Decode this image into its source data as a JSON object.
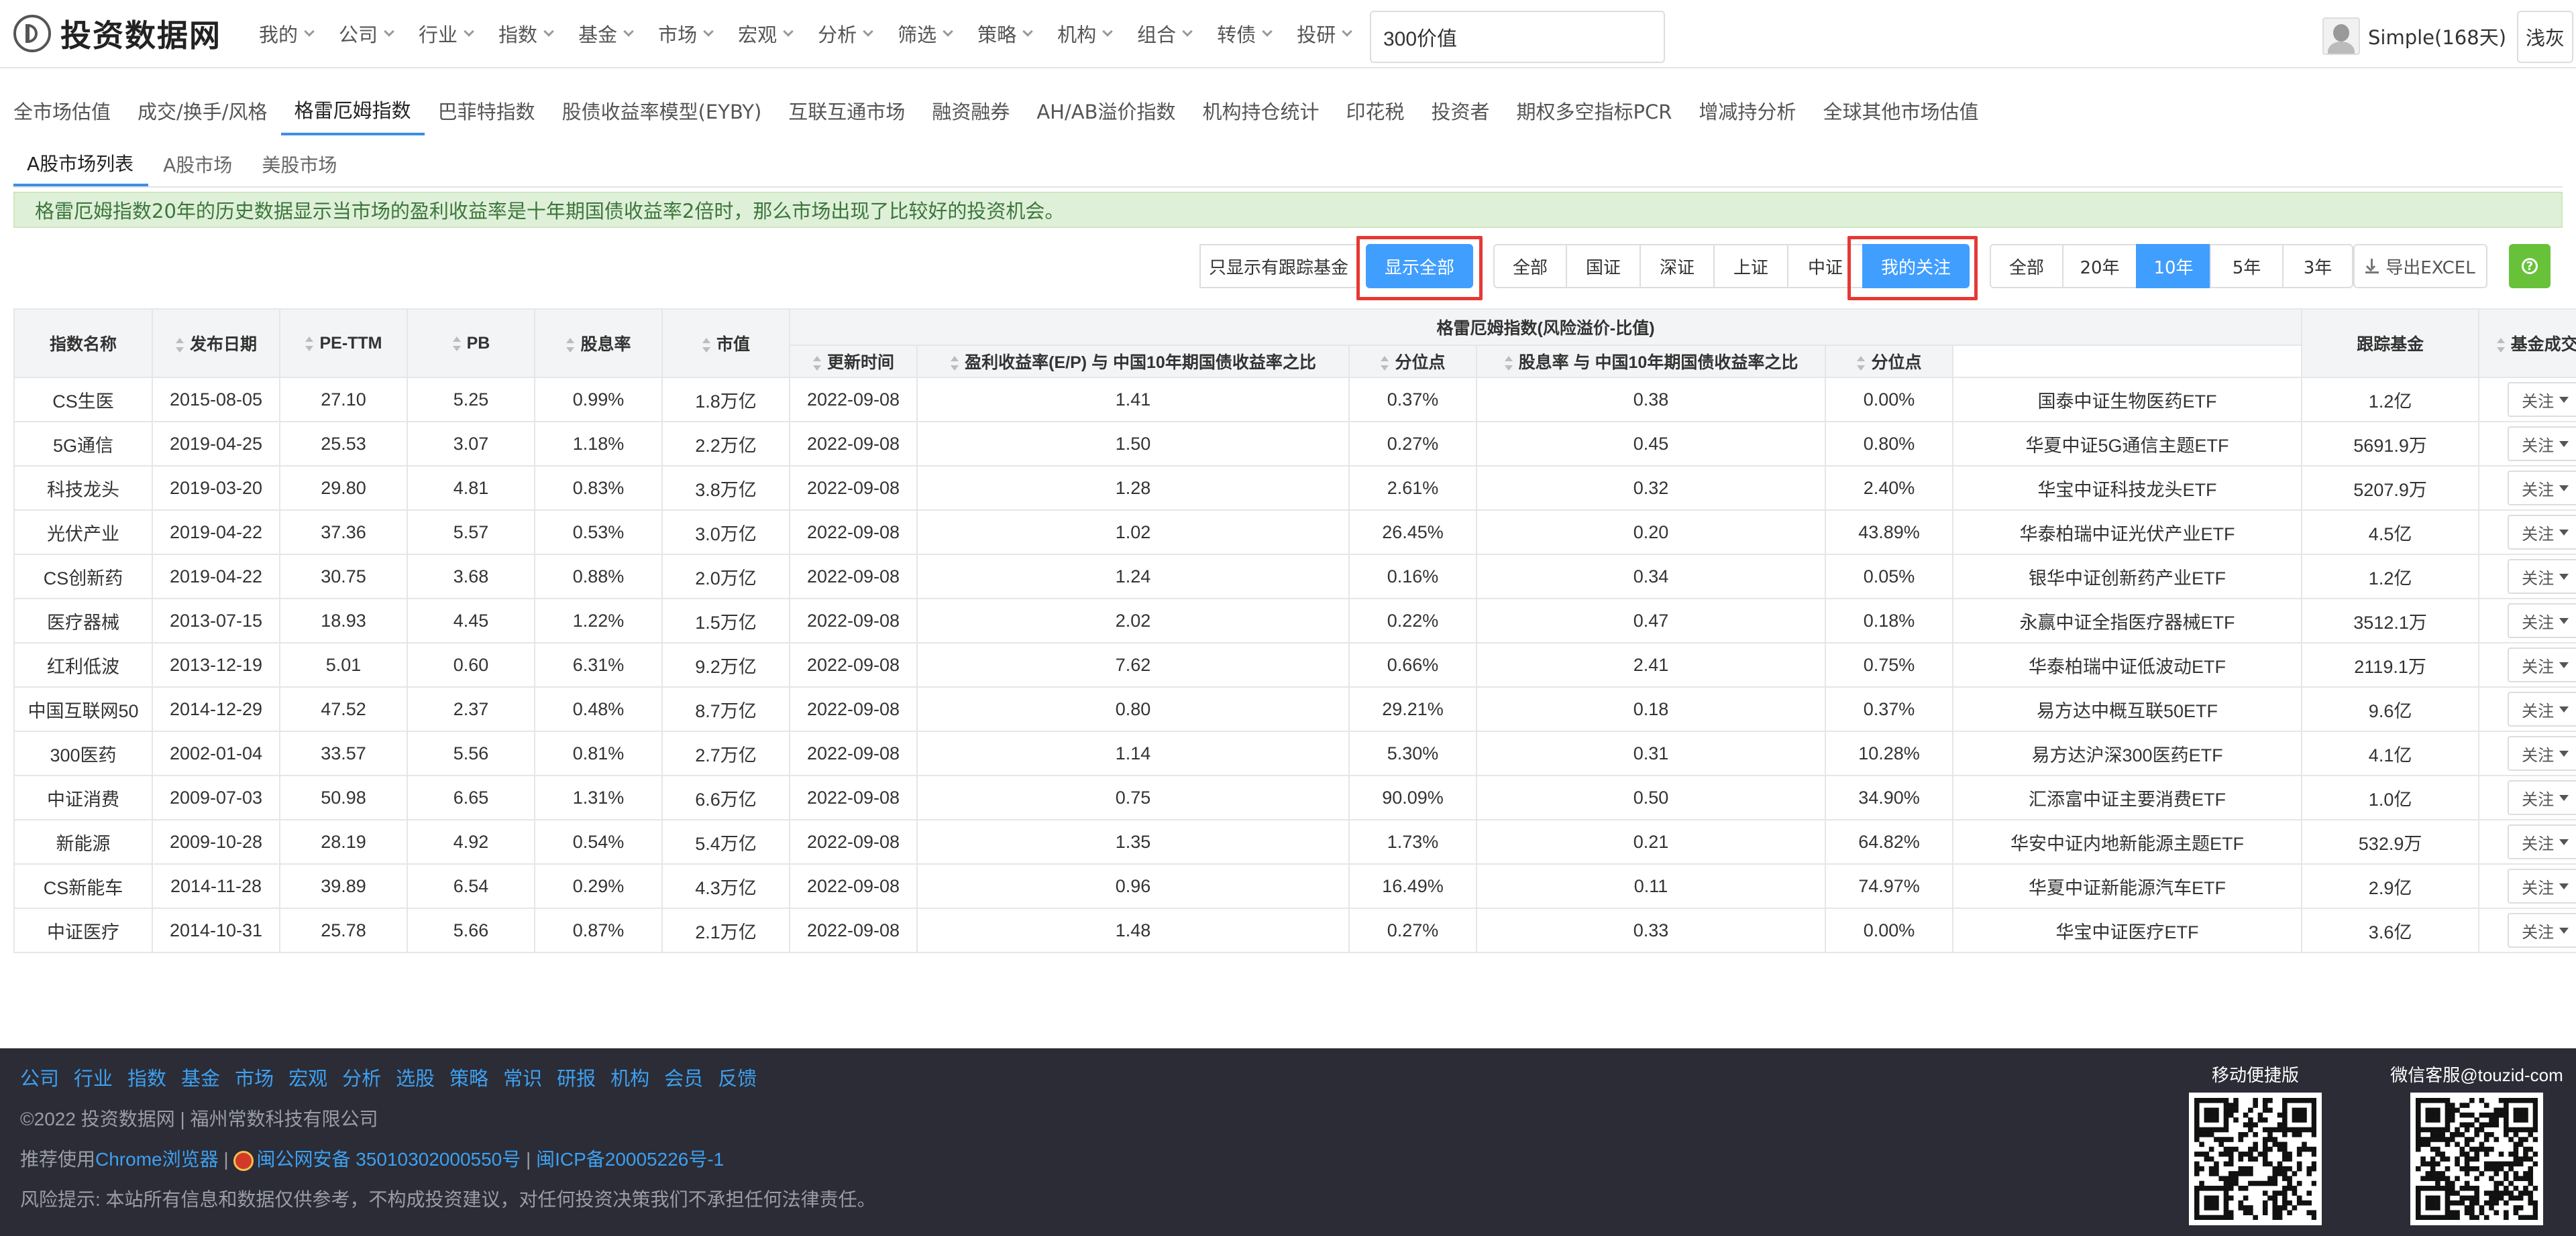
{
  "header": {
    "site_name": "投资数据网",
    "nav": [
      "我的",
      "公司",
      "行业",
      "指数",
      "基金",
      "市场",
      "宏观",
      "分析",
      "筛选",
      "策略",
      "机构",
      "组合",
      "转债",
      "投研"
    ],
    "search_value": "300价值",
    "user_name": "Simple(168天)",
    "theme_label": "浅灰"
  },
  "tabs": {
    "primary": [
      "全市场估值",
      "成交/换手/风格",
      "格雷厄姆指数",
      "巴菲特指数",
      "股债收益率模型(EYBY)",
      "互联互通市场",
      "融资融券",
      "AH/AB溢价指数",
      "机构持仓统计",
      "印花税",
      "投资者",
      "期权多空指标PCR",
      "增减持分析",
      "全球其他市场估值"
    ],
    "primary_active": "格雷厄姆指数",
    "secondary": [
      "A股市场列表",
      "A股市场",
      "美股市场"
    ],
    "secondary_active": "A股市场列表"
  },
  "notice": "格雷厄姆指数20年的历史数据显示当市场的盈利收益率是十年期国债收益率2倍时，那么市场出现了比较好的投资机会。",
  "filters": {
    "tracking_only": "只显示有跟踪基金",
    "show_all": "显示全部",
    "markets": [
      "全部",
      "国证",
      "深证",
      "上证",
      "中证",
      "我的关注"
    ],
    "periods": [
      "全部",
      "20年",
      "10年",
      "5年",
      "3年"
    ],
    "period_active": "10年",
    "export": "导出EXCEL",
    "help": "?"
  },
  "table": {
    "headers": {
      "name": "指数名称",
      "date": "发布日期",
      "pe": "PE-TTM",
      "pb": "PB",
      "dy": "股息率",
      "mcap": "市值",
      "group": "格雷厄姆指数(风险溢价-比值)",
      "update": "更新时间",
      "ep_ratio": "盈利收益率(E/P) 与 中国10年期国债收益率之比",
      "pct1": "分位点",
      "dy_ratio": "股息率 与 中国10年期国债收益率之比",
      "pct2": "分位点",
      "fund": "跟踪基金",
      "fund_volume": "基金成交额",
      "follow": "关注"
    },
    "follow_label": "关注",
    "rows": [
      {
        "name": "CS生医",
        "date": "2015-08-05",
        "pe": "27.10",
        "pb": "5.25",
        "dy": "0.99%",
        "mcap": "1.8万亿",
        "update": "2022-09-08",
        "ep": "1.41",
        "p1": "0.37%",
        "p1c": "g",
        "dyr": "0.38",
        "p2": "0.00%",
        "p2c": "g",
        "fund": "国泰中证生物医药ETF",
        "vol": "1.2亿"
      },
      {
        "name": "5G通信",
        "date": "2019-04-25",
        "pe": "25.53",
        "pb": "3.07",
        "dy": "1.18%",
        "mcap": "2.2万亿",
        "update": "2022-09-08",
        "ep": "1.50",
        "p1": "0.27%",
        "p1c": "g",
        "dyr": "0.45",
        "p2": "0.80%",
        "p2c": "g",
        "fund": "华夏中证5G通信主题ETF",
        "vol": "5691.9万"
      },
      {
        "name": "科技龙头",
        "date": "2019-03-20",
        "pe": "29.80",
        "pb": "4.81",
        "dy": "0.83%",
        "mcap": "3.8万亿",
        "update": "2022-09-08",
        "ep": "1.28",
        "p1": "2.61%",
        "p1c": "g",
        "dyr": "0.32",
        "p2": "2.40%",
        "p2c": "g",
        "fund": "华宝中证科技龙头ETF",
        "vol": "5207.9万"
      },
      {
        "name": "光伏产业",
        "date": "2019-04-22",
        "pe": "37.36",
        "pb": "5.57",
        "dy": "0.53%",
        "mcap": "3.0万亿",
        "update": "2022-09-08",
        "ep": "1.02",
        "p1": "26.45%",
        "p1c": "b",
        "dyr": "0.20",
        "p2": "43.89%",
        "p2c": "b",
        "fund": "华泰柏瑞中证光伏产业ETF",
        "vol": "4.5亿"
      },
      {
        "name": "CS创新药",
        "date": "2019-04-22",
        "pe": "30.75",
        "pb": "3.68",
        "dy": "0.88%",
        "mcap": "2.0万亿",
        "update": "2022-09-08",
        "ep": "1.24",
        "p1": "0.16%",
        "p1c": "g",
        "dyr": "0.34",
        "p2": "0.05%",
        "p2c": "g",
        "fund": "银华中证创新药产业ETF",
        "vol": "1.2亿"
      },
      {
        "name": "医疗器械",
        "date": "2013-07-15",
        "pe": "18.93",
        "pb": "4.45",
        "dy": "1.22%",
        "mcap": "1.5万亿",
        "update": "2022-09-08",
        "ep": "2.02",
        "p1": "0.22%",
        "p1c": "g",
        "dyr": "0.47",
        "p2": "0.18%",
        "p2c": "g",
        "fund": "永赢中证全指医疗器械ETF",
        "vol": "3512.1万"
      },
      {
        "name": "红利低波",
        "date": "2013-12-19",
        "pe": "5.01",
        "pb": "0.60",
        "dy": "6.31%",
        "mcap": "9.2万亿",
        "update": "2022-09-08",
        "ep": "7.62",
        "p1": "0.66%",
        "p1c": "g",
        "dyr": "2.41",
        "p2": "0.75%",
        "p2c": "g",
        "fund": "华泰柏瑞中证低波动ETF",
        "vol": "2119.1万"
      },
      {
        "name": "中国互联网50",
        "date": "2014-12-29",
        "pe": "47.52",
        "pb": "2.37",
        "dy": "0.48%",
        "mcap": "8.7万亿",
        "update": "2022-09-08",
        "ep": "0.80",
        "p1": "29.21%",
        "p1c": "b",
        "dyr": "0.18",
        "p2": "0.37%",
        "p2c": "g",
        "fund": "易方达中概互联50ETF",
        "vol": "9.6亿"
      },
      {
        "name": "300医药",
        "date": "2002-01-04",
        "pe": "33.57",
        "pb": "5.56",
        "dy": "0.81%",
        "mcap": "2.7万亿",
        "update": "2022-09-08",
        "ep": "1.14",
        "p1": "5.30%",
        "p1c": "g",
        "dyr": "0.31",
        "p2": "10.28%",
        "p2c": "g",
        "fund": "易方达沪深300医药ETF",
        "vol": "4.1亿"
      },
      {
        "name": "中证消费",
        "date": "2009-07-03",
        "pe": "50.98",
        "pb": "6.65",
        "dy": "1.31%",
        "mcap": "6.6万亿",
        "update": "2022-09-08",
        "ep": "0.75",
        "p1": "90.09%",
        "p1c": "r",
        "dyr": "0.50",
        "p2": "34.90%",
        "p2c": "b",
        "fund": "汇添富中证主要消费ETF",
        "vol": "1.0亿"
      },
      {
        "name": "新能源",
        "date": "2009-10-28",
        "pe": "28.19",
        "pb": "4.92",
        "dy": "0.54%",
        "mcap": "5.4万亿",
        "update": "2022-09-08",
        "ep": "1.35",
        "p1": "1.73%",
        "p1c": "g",
        "dyr": "0.21",
        "p2": "64.82%",
        "p2c": "b",
        "fund": "华安中证内地新能源主题ETF",
        "vol": "532.9万"
      },
      {
        "name": "CS新能车",
        "date": "2014-11-28",
        "pe": "39.89",
        "pb": "6.54",
        "dy": "0.29%",
        "mcap": "4.3万亿",
        "update": "2022-09-08",
        "ep": "0.96",
        "p1": "16.49%",
        "p1c": "g",
        "dyr": "0.11",
        "p2": "74.97%",
        "p2c": "b",
        "fund": "华夏中证新能源汽车ETF",
        "vol": "2.9亿"
      },
      {
        "name": "中证医疗",
        "date": "2014-10-31",
        "pe": "25.78",
        "pb": "5.66",
        "dy": "0.87%",
        "mcap": "2.1万亿",
        "update": "2022-09-08",
        "ep": "1.48",
        "p1": "0.27%",
        "p1c": "g",
        "dyr": "0.33",
        "p2": "0.00%",
        "p2c": "g",
        "fund": "华宝中证医疗ETF",
        "vol": "3.6亿"
      }
    ]
  },
  "footer": {
    "links": [
      "公司",
      "行业",
      "指数",
      "基金",
      "市场",
      "宏观",
      "分析",
      "选股",
      "策略",
      "常识",
      "研报",
      "机构",
      "会员",
      "反馈"
    ],
    "copyright": "©2022 投资数据网 | 福州常数科技有限公司",
    "browser_prefix": "推荐使用",
    "browser_link": "Chrome浏览器",
    "sep1": " | ",
    "police": "闽公网安备 35010302000550号",
    "sep2": " | ",
    "icp": "闽ICP备20005226号-1",
    "risk": "风险提示: 本站所有信息和数据仅供参考，不构成投资建议，对任何投资决策我们不承担任何法律责任。",
    "qr_mobile_title": "移动便捷版",
    "qr_wechat_title": "微信客服@touzid-com"
  },
  "colors": {
    "accent": "#409eff",
    "link": "#2f87e8",
    "green": "#1a9b1a",
    "red": "#e32222",
    "highlight": "#e53935",
    "footer_bg": "#2b2c36"
  }
}
